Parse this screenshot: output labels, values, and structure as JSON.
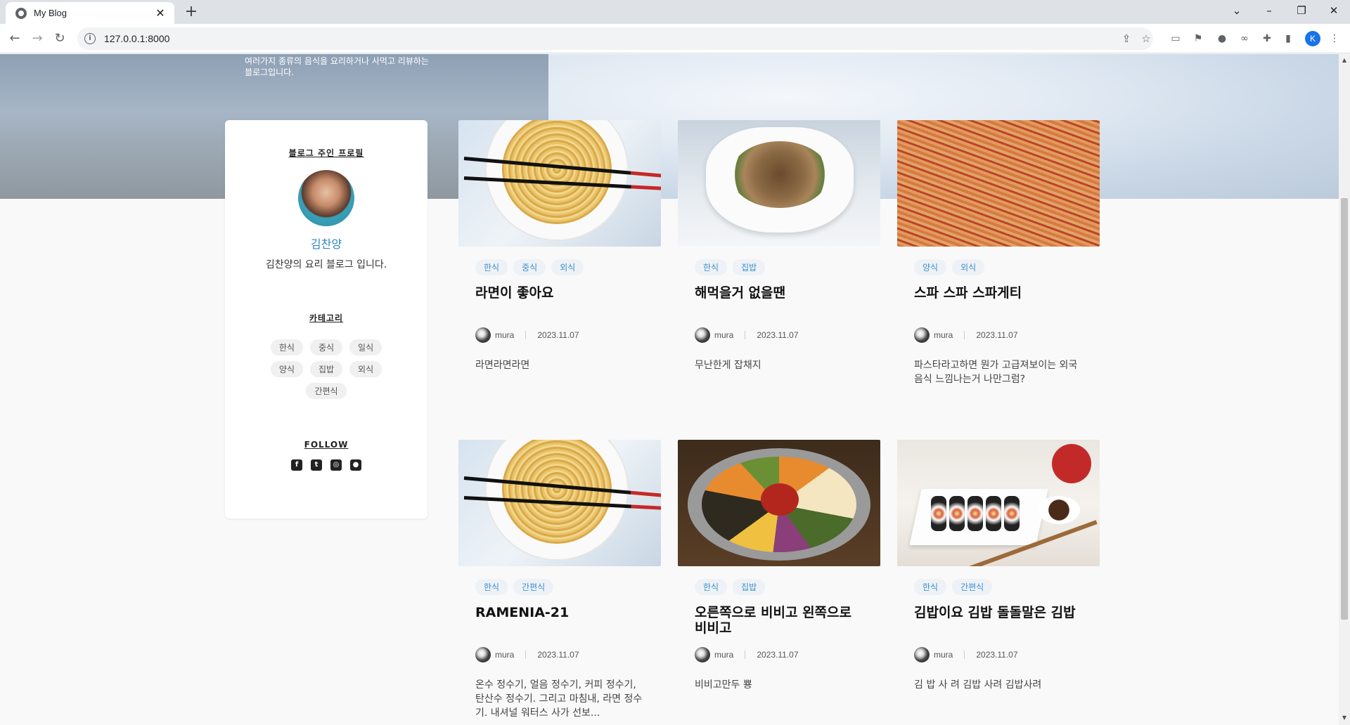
{
  "browser": {
    "tab_title": "My Blog",
    "tab_close": "✕",
    "new_tab": "+",
    "url": "127.0.0.1:8000",
    "profile_initial": "K"
  },
  "hero": {
    "description": "여러가지 종류의 음식을 요리하거나 사먹고 리뷰하는 블로그입니다."
  },
  "profile": {
    "heading": "블로그 주인 프로필",
    "name": "김찬양",
    "bio": "김찬양의 요리 블로그 입니다.",
    "category_heading": "카테고리",
    "categories": [
      "한식",
      "중식",
      "일식",
      "양식",
      "집밥",
      "외식",
      "간편식"
    ],
    "follow_heading": "FOLLOW"
  },
  "posts": [
    {
      "tags": [
        "한식",
        "중식",
        "외식"
      ],
      "title": "라면이 좋아요",
      "author": "mura",
      "date": "2023.11.07",
      "excerpt": "라면라면라면",
      "image": "ramen"
    },
    {
      "tags": [
        "한식",
        "집밥"
      ],
      "title": "해먹을거 없을땐",
      "author": "mura",
      "date": "2023.11.07",
      "excerpt": "무난한게 잡채지",
      "image": "japchae"
    },
    {
      "tags": [
        "양식",
        "외식"
      ],
      "title": "스파 스파 스파게티",
      "author": "mura",
      "date": "2023.11.07",
      "excerpt": "파스타라고하면 뭔가 고급져보이는 외국음식 느낌나는거 나만그럼?",
      "image": "spaghetti"
    },
    {
      "tags": [
        "한식",
        "간편식"
      ],
      "title": "RAMENIA-21",
      "author": "mura",
      "date": "2023.11.07",
      "excerpt": "온수 정수기, 얼음 정수기, 커피 정수기, 탄산수 정수기. 그리고 마침내, 라면 정수기. 내셔널 워터스 사가 선보...",
      "image": "ramen"
    },
    {
      "tags": [
        "한식",
        "집밥"
      ],
      "title": "오른쪽으로 비비고 왼쪽으로 비비고",
      "author": "mura",
      "date": "2023.11.07",
      "excerpt": "비비고만두 뿅",
      "image": "bibimbap"
    },
    {
      "tags": [
        "한식",
        "간편식"
      ],
      "title": "김밥이요 김밥 돌돌말은 김밥",
      "author": "mura",
      "date": "2023.11.07",
      "excerpt": "김 밥 사 려 김밥 사려 김밥사려",
      "image": "gimbap"
    }
  ]
}
